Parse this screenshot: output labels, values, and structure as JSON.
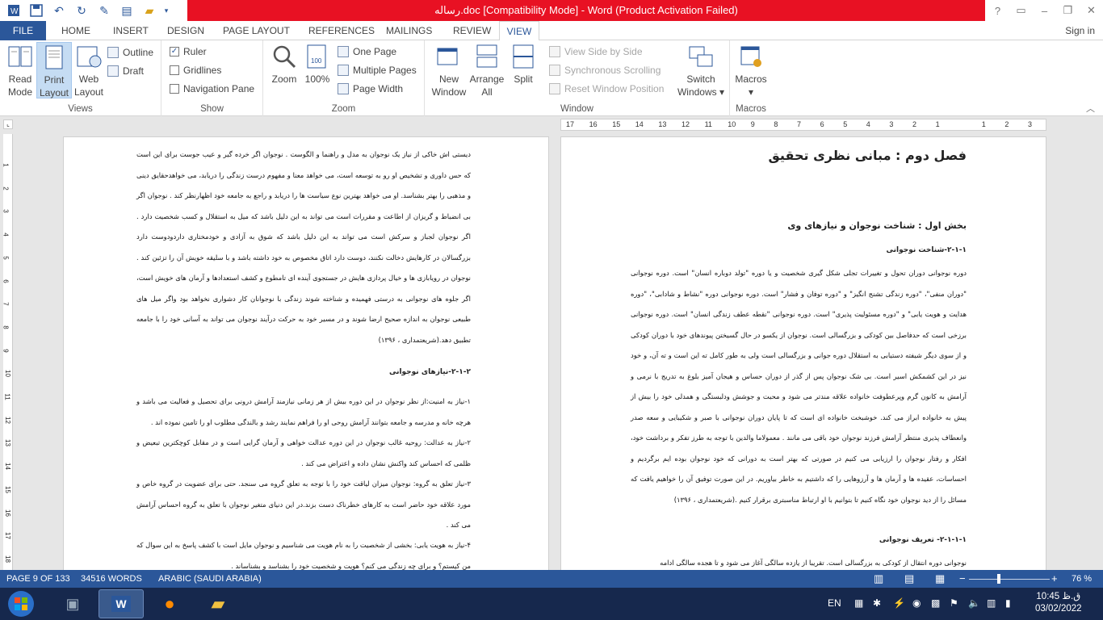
{
  "titlebar": {
    "title": "رساله.doc [Compatibility Mode] -  Word (Product Activation Failed)",
    "help": "?",
    "min": "–",
    "restore": "❐",
    "close": "✕"
  },
  "tabs": {
    "file": "FILE",
    "items": [
      "HOME",
      "INSERT",
      "DESIGN",
      "PAGE LAYOUT",
      "REFERENCES",
      "MAILINGS",
      "REVIEW"
    ],
    "active": "VIEW",
    "signin": "Sign in"
  },
  "ribbon": {
    "views": {
      "label": "Views",
      "read_mode": [
        "Read",
        "Mode"
      ],
      "print_layout": [
        "Print",
        "Layout"
      ],
      "web_layout": [
        "Web",
        "Layout"
      ],
      "outline": "Outline",
      "draft": "Draft"
    },
    "show": {
      "label": "Show",
      "ruler": "Ruler",
      "gridlines": "Gridlines",
      "nav_pane": "Navigation Pane"
    },
    "zoom": {
      "label": "Zoom",
      "zoom": "Zoom",
      "hundred": "100%",
      "one_page": "One Page",
      "multiple_pages": "Multiple Pages",
      "page_width": "Page Width"
    },
    "window": {
      "label": "Window",
      "new_window": [
        "New",
        "Window"
      ],
      "arrange_all": [
        "Arrange",
        "All"
      ],
      "split": "Split",
      "side_by_side": "View Side by Side",
      "sync_scroll": "Synchronous Scrolling",
      "reset_pos": "Reset Window Position",
      "switch_windows": [
        "Switch",
        "Windows ▾"
      ]
    },
    "macros": {
      "label": "Macros",
      "macros": "Macros",
      "dropdown": "▾"
    }
  },
  "ruler": {
    "ticks": [
      "17",
      "16",
      "15",
      "14",
      "13",
      "12",
      "11",
      "10",
      "9",
      "8",
      "7",
      "6",
      "5",
      "4",
      "3",
      "2",
      "1",
      "",
      "1",
      "2",
      "3"
    ],
    "vticks": [
      "1",
      "2",
      "3",
      "4",
      "5",
      "6",
      "7",
      "8",
      "9",
      "10",
      "11",
      "12",
      "13",
      "14",
      "15",
      "16",
      "17",
      "18"
    ]
  },
  "page_left": {
    "para1": "دیستی اش خاکی از نیاز یک نوجوان به مدل و راهنما و الگوست . نوجوان اگر خرده گیر و عیب جوست برای این است که حس داوری و تشخیص او رو به توسعه است، می خواهد معنا و مفهوم درست زندگی را دریابد، می خواهدحقایق دینی و مذهبی را بهتر بشناسد. او می خواهد بهترین نوع سیاست ها را دریابد و راجع به جامعه خود اظهارنظر کند . نوجوان اگر بی انضباط و گریزان از اطاعت و مقررات است می تواند به این دلیل باشد که میل به استقلال و کسب شخصیت دارد . اگر نوجوان لجباز و سرکش است می تواند به این دلیل باشد که شوق به آزادی و خودمختاری داردودوست دارد بزرگسالان در کارهایش دخالت نکنند، دوست دارد اتاق مخصوص به خود داشته باشد و با سلیقه خویش آن را تزئین کند . نوجوان در رویابازی ها و خیال پردازی هایش در جستجوی آینده ای تامطوع و کشف استعدادها و آرمان های خویش است، اگر جلوه های نوجوانی به درستی فهمیده و شناخته شوند زندگی با نوجوانان کار دشواری نخواهد بود واگر میل های طبیعی نوجوان به اندازه صحیح ارضا شوند و در مسیر خود به حرکت درآیند نوجوان می تواند به آسانی خود را با جامعه تطبیق دهد.(شریعتمداری ، ۱۳۹۶)",
    "heading": "۲-۱-۲-نیازهای نوجوانی",
    "para2": "۱-نیاز به امنیت:از نظر نوجوان در این دوره بیش از هر زمانی نیازمند آرامش درونی برای تحصیل و فعالیت می باشد و هرچه خانه و مدرسه و جامعه بتوانند آرامش روحی او را فراهم نمایند رشد و بالندگی مطلوب او را تامین نموده اند .",
    "para3": "۲-نیاز به عدالت: روحیه غالب نوجوان در این دوره عدالت خواهی و آرمان گرایی است و در مقابل کوچکترین تبعیض و ظلمی که احساس کند واکنش نشان داده و اعتراض می کند .",
    "para4": "۳-نیاز تعلق به گروه: نوجوان میزان لیاقت خود را با توجه به تعلق گروه می سنجد. حتی برای عضویت در گروه خاص و مورد علاقه خود حاضر است به کارهای خطرناک دست بزند.در این دنیای متغیر نوجوان با تعلق به گروه احساس آرامش می کند .",
    "para5": "۴-نیاز به هویت یابی: بخشی از شخصیت را به نام هویت می شناسیم و نوجوان مایل است با کشف پاسخ به این سوال که من کیستم؟ و برای چه زندگی می کنم؟ هویت و شخصیت خود را بشناسد و بشناساند ."
  },
  "page_right": {
    "chapter": "فصل دوم : مبانی نظری تحقیق",
    "section": "بخش اول : شناخت نوجوان و نیازهای وی",
    "sub1": "۲-۱-۱-شناخت نوجوانی",
    "para1": "دوره نوجوانی دوران تحول و تغییرات تجلی شکل گیری شخصیت و یا دوره \"تولد دوباره انسان\" است. دوره نوجوانی \"دوران منفی\"، \"دوره زندگی تشنج انگیز\" و \"دوره توفان و فشار\" است. دوره نوجوانی دوره \"نشاط و شادابی\"، \"دوره هدایت و هویت یابی\" و \"دوره مسئولیت پذیری\" است. دوره نوجوانی \"نقطه عطف زندگی انسان\" است. دوره نوجوانی برزخی است که حدفاصل بین کودکی و بزرگسالی است. نوجوان از یکسو در حال گسیختن پیوندهای خود با دوران کودکی و از سوی دیگر شیفته دستیابی به استقلال دوره جوانی و بزرگسالی است ولی به طور کامل ته این است و ته آن، و خود نیز در این کشمکش اسیر است. بی شک نوجوان پس از گذر از دوران حساس و هیجان آمیز بلوغ به تدریج با نرمی و آرامش به کانون گرم وپرعطوفت خانواده علاقه مندتر می شود و محبت و جوشش ودلبستگی و همدلی خود را بیش از پیش به خانواده ابراز می کند. خوشبخت خانواده ای است که تا پایان دوران نوجوانی با صبر و شکیبایی و سعه صدر وانعطاف پذیری منتظر آرامش فرزند نوجوان خود باقی می مانند . معمولاما والدین با توجه به طرز تفکر و برداشت خود، افکار و رفتار نوجوان را ارزیابی می کنیم در صورتی که بهتر است به دورانی که خود نوجوان بوده ایم برگردیم و احساسات، عقیده ها و آرمان ها و آرزوهایی را که داشتیم به خاطر بیاوریم. در این صورت توفیق آن را خواهیم یافت که مسائل را از دید نوجوان خود نگاه کنیم تا بتوانیم با او ارتباط مناسبتری برقرار کنیم .(شریعتمداری ، ۱۳۹۶)",
    "sub2": "۲-۱-۱-۱- تعریف نوجوانی",
    "para2": "نوجوانی دوره انتقال از کودکی به بزرگسالی است. تقریبا از یازده سالگی آغاز می شود و تا هجده سالگی ادامه"
  },
  "status": {
    "page": "PAGE 9 OF 133",
    "words": "34516 WORDS",
    "lang": "ARABIC (SAUDI ARABIA)",
    "zoom": "76 %",
    "minus": "−",
    "plus": "+"
  },
  "taskbar": {
    "lang": "EN",
    "time": "10:45 ق.ظ",
    "date": "03/02/2022"
  }
}
